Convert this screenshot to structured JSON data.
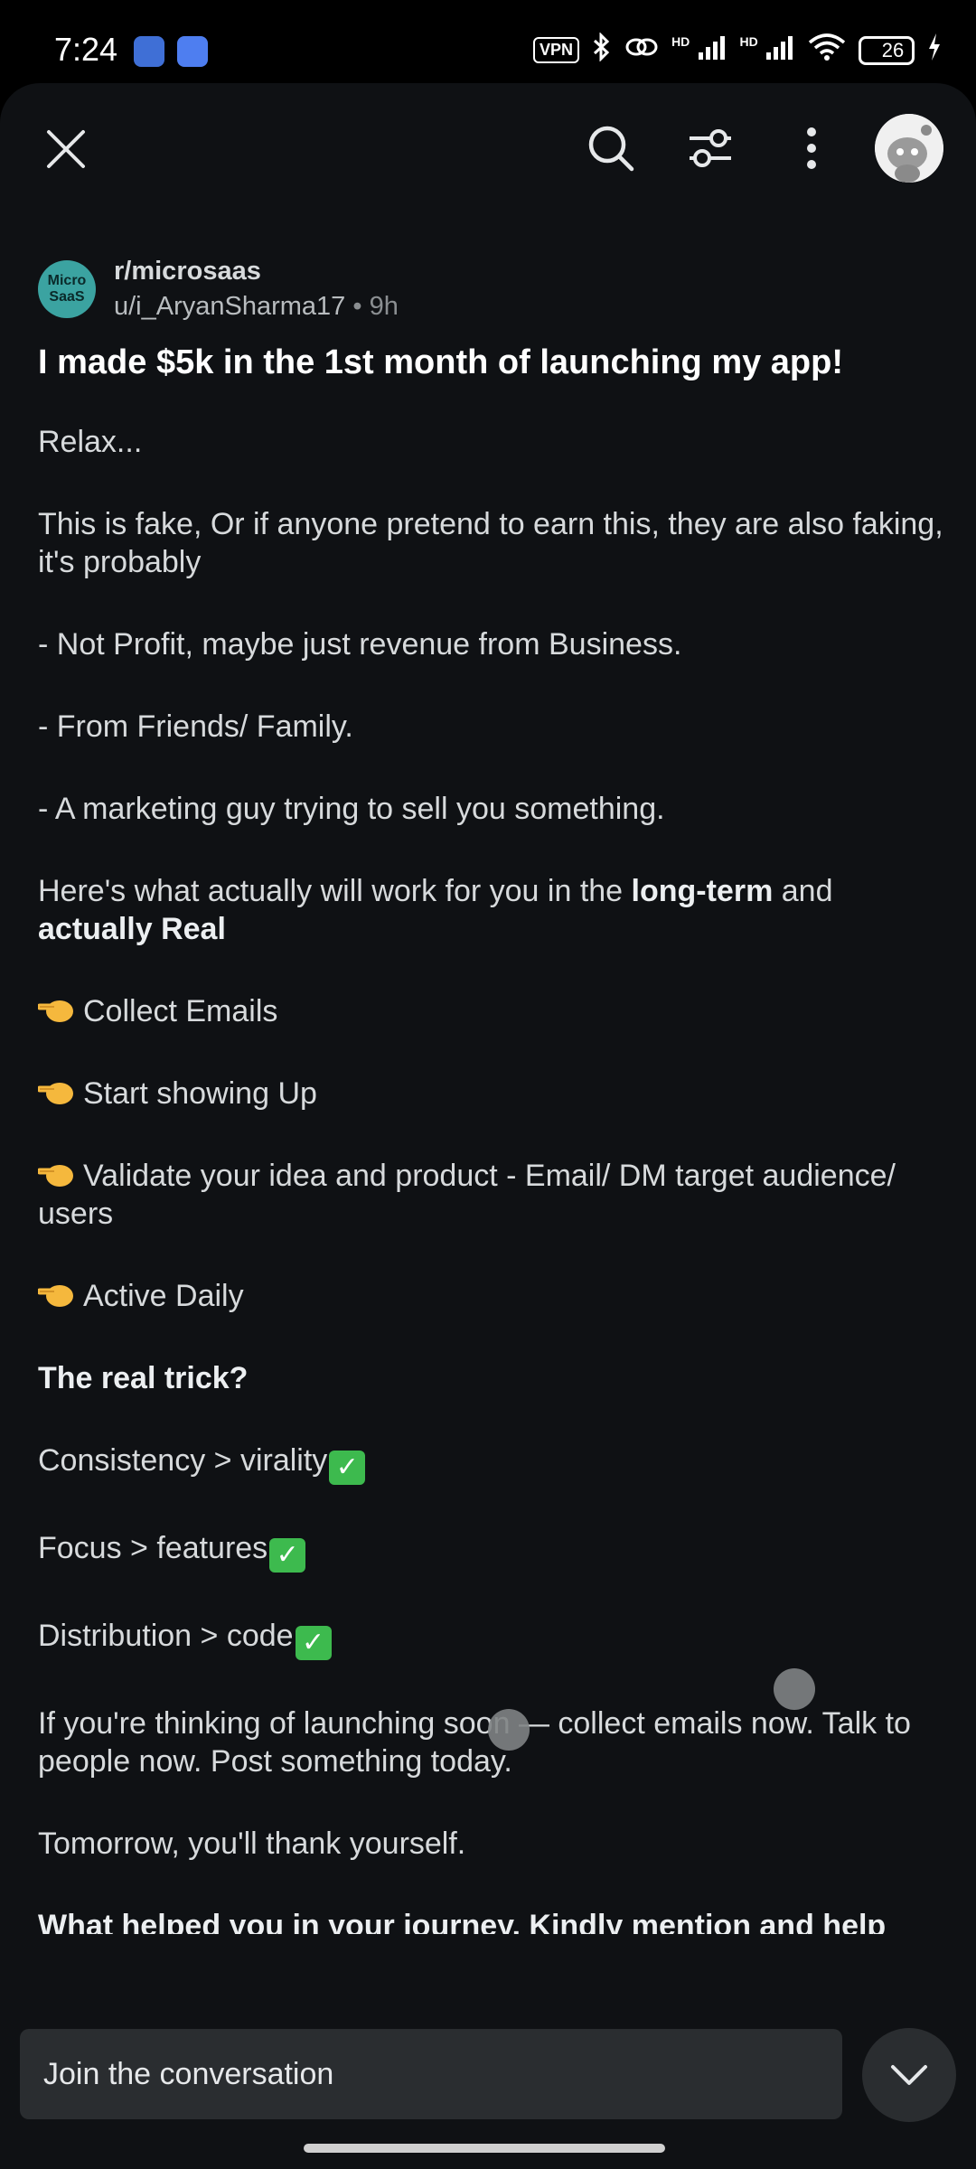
{
  "status_bar": {
    "time": "7:24",
    "vpn": "VPN",
    "hd1": "HD",
    "hd2": "HD",
    "battery": "26"
  },
  "top_bar": {
    "icons": [
      "close-icon",
      "search-icon",
      "filter-icon",
      "more-vertical-icon",
      "user-avatar"
    ]
  },
  "post": {
    "community_avatar_text_1": "Micro",
    "community_avatar_text_2": "SaaS",
    "subreddit": "r/microsaas",
    "author": "u/i_AryanSharma17",
    "separator": " • ",
    "time": "9h",
    "title": "I made $5k in the 1st month of launching my app!",
    "body": {
      "p1": "Relax...",
      "p2": "This is fake, Or if anyone pretend to earn this, they are also faking, it's probably",
      "p3": "- Not Profit, maybe just revenue from Business.",
      "p4": "- From Friends/ Family.",
      "p5": "- A marketing guy trying to sell you something.",
      "p6_a": "Here's what actually will work for you in the ",
      "p6_b": "long-term",
      "p6_c": " and ",
      "p6_d": "actually Real",
      "p7": "Collect Emails",
      "p8": "Start showing Up",
      "p9": "Validate your idea and product - Email/ DM target audience/ users",
      "p10": "Active Daily",
      "p11": "The real trick?",
      "p12": "Consistency > virality",
      "p13": "Focus > features",
      "p14": "Distribution > code",
      "p15": "If you're thinking of launching soon — collect emails now. Talk to people now. Post something today.",
      "p16": "Tomorrow, you'll thank yourself.",
      "p17": "What helped you in your journey, Kindly mention and help others?"
    }
  },
  "bottom": {
    "join_placeholder": "Join the conversation"
  },
  "colors": {
    "background": "#0f1114",
    "text": "#d7dadc",
    "check": "#3dba4e",
    "input_bg": "#2a2d30"
  }
}
